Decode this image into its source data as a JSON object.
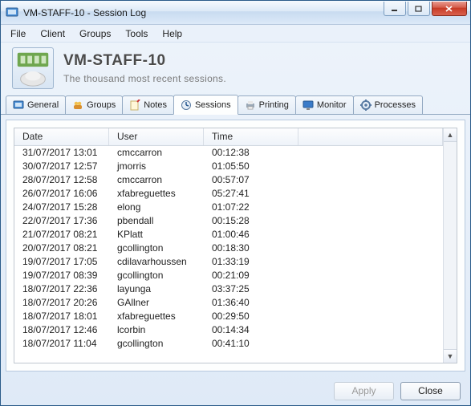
{
  "window": {
    "title": "VM-STAFF-10 - Session Log"
  },
  "menu": [
    "File",
    "Client",
    "Groups",
    "Tools",
    "Help"
  ],
  "header": {
    "name": "VM-STAFF-10",
    "subtitle": "The thousand most recent sessions."
  },
  "tabs": [
    {
      "icon": "general-icon",
      "label": "General"
    },
    {
      "icon": "groups-icon",
      "label": "Groups"
    },
    {
      "icon": "notes-icon",
      "label": "Notes"
    },
    {
      "icon": "sessions-icon",
      "label": "Sessions"
    },
    {
      "icon": "printing-icon",
      "label": "Printing"
    },
    {
      "icon": "monitor-icon",
      "label": "Monitor"
    },
    {
      "icon": "processes-icon",
      "label": "Processes"
    }
  ],
  "active_tab": 3,
  "columns": {
    "date": "Date",
    "user": "User",
    "time": "Time"
  },
  "sessions": [
    {
      "date": "31/07/2017 13:01",
      "user": "cmccarron",
      "time": "00:12:38"
    },
    {
      "date": "30/07/2017 12:57",
      "user": "jmorris",
      "time": "01:05:50"
    },
    {
      "date": "28/07/2017 12:58",
      "user": "cmccarron",
      "time": "00:57:07"
    },
    {
      "date": "26/07/2017 16:06",
      "user": "xfabreguettes",
      "time": "05:27:41"
    },
    {
      "date": "24/07/2017 15:28",
      "user": "elong",
      "time": "01:07:22"
    },
    {
      "date": "22/07/2017 17:36",
      "user": "pbendall",
      "time": "00:15:28"
    },
    {
      "date": "21/07/2017 08:21",
      "user": "KPlatt",
      "time": "01:00:46"
    },
    {
      "date": "20/07/2017 08:21",
      "user": "gcollington",
      "time": "00:18:30"
    },
    {
      "date": "19/07/2017 17:05",
      "user": "cdilavarhoussen",
      "time": "01:33:19"
    },
    {
      "date": "19/07/2017 08:39",
      "user": "gcollington",
      "time": "00:21:09"
    },
    {
      "date": "18/07/2017 22:36",
      "user": "layunga",
      "time": "03:37:25"
    },
    {
      "date": "18/07/2017 20:26",
      "user": "GAllner",
      "time": "01:36:40"
    },
    {
      "date": "18/07/2017 18:01",
      "user": "xfabreguettes",
      "time": "00:29:50"
    },
    {
      "date": "18/07/2017 12:46",
      "user": "lcorbin",
      "time": "00:14:34"
    },
    {
      "date": "18/07/2017 11:04",
      "user": "gcollington",
      "time": "00:41:10"
    }
  ],
  "buttons": {
    "apply": "Apply",
    "close": "Close"
  }
}
